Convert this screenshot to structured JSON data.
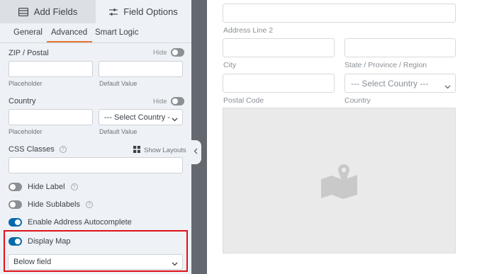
{
  "panel": {
    "tabs": [
      {
        "label": "Add Fields",
        "icon": "table-list-icon"
      },
      {
        "label": "Field Options",
        "icon": "sliders-icon"
      }
    ],
    "subtabs": [
      "General",
      "Advanced",
      "Smart Logic"
    ],
    "active_subtab": "Advanced",
    "zip": {
      "label": "ZIP / Postal",
      "hide_label": "Hide",
      "placeholder_caption": "Placeholder",
      "default_caption": "Default Value"
    },
    "country": {
      "label": "Country",
      "hide_label": "Hide",
      "select_value": "--- Select Country ---",
      "placeholder_caption": "Placeholder",
      "default_caption": "Default Value"
    },
    "css": {
      "label": "CSS Classes",
      "help": "?",
      "show_layouts": "Show Layouts"
    },
    "toggles": [
      {
        "label": "Hide Label",
        "on": false,
        "help": "?"
      },
      {
        "label": "Hide Sublabels",
        "on": false,
        "help": "?"
      },
      {
        "label": "Enable Address Autocomplete",
        "on": true
      },
      {
        "label": "Display Map",
        "on": true
      }
    ],
    "map_position": "Below field"
  },
  "preview": {
    "address_line2_label": "Address Line 2",
    "city_label": "City",
    "state_label": "State / Province / Region",
    "postal_label": "Postal Code",
    "country_label": "Country",
    "country_select": "--- Select Country ---"
  },
  "colors": {
    "accent": "#e27730",
    "toggle_on": "#056aab",
    "highlight": "#e0121b"
  }
}
